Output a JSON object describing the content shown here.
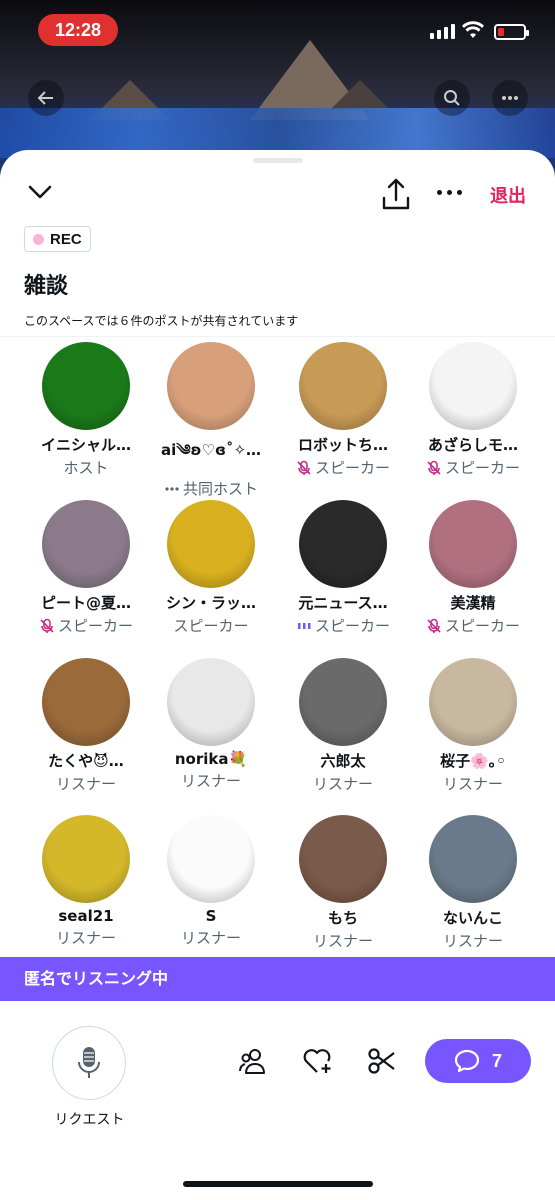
{
  "status_bar": {
    "time": "12:28"
  },
  "header": {
    "leave_label": "退出"
  },
  "space": {
    "rec_label": "REC",
    "title": "雑談",
    "subtitle": "このスペースでは６件のポストが共有されています"
  },
  "participants": [
    {
      "name": "イニシャル…",
      "role": "ホスト",
      "role_icon": "none",
      "avatar_color": "#1a7a1a"
    },
    {
      "name": "ai༄ʚ♡ɞ˚✧…",
      "role": "共同ホスト",
      "role_icon": "dots-icon",
      "avatar_color": "#d8a07a"
    },
    {
      "name": "ロボットち…",
      "role": "スピーカー",
      "role_icon": "muted-mic-icon",
      "avatar_color": "#c79a55"
    },
    {
      "name": "あざらしモ…",
      "role": "スピーカー",
      "role_icon": "muted-mic-icon",
      "avatar_color": "#f4f4f4"
    },
    {
      "name": "ピート@夏…",
      "role": "スピーカー",
      "role_icon": "muted-mic-icon",
      "avatar_color": "#8a7a8a"
    },
    {
      "name": "シン・ラッ…",
      "role": "スピーカー",
      "role_icon": "none",
      "avatar_color": "#d9b020"
    },
    {
      "name": "元ニュース…",
      "role": "スピーカー",
      "role_icon": "speaking-bars-icon",
      "avatar_color": "#2a2a2a"
    },
    {
      "name": "美漢精",
      "role": "スピーカー",
      "role_icon": "muted-mic-icon",
      "avatar_color": "#b07080"
    },
    {
      "name": "たくや😈…",
      "role": "リスナー",
      "role_icon": "none",
      "avatar_color": "#9a6a3a"
    },
    {
      "name": "norika💐",
      "role": "リスナー",
      "role_icon": "none",
      "avatar_color": "#e8e8e8"
    },
    {
      "name": "六郎太",
      "role": "リスナー",
      "role_icon": "none",
      "avatar_color": "#6a6a6a"
    },
    {
      "name": "桜子🌸｡◦",
      "role": "リスナー",
      "role_icon": "none",
      "avatar_color": "#c8b8a0"
    },
    {
      "name": "seal21",
      "role": "リスナー",
      "role_icon": "none",
      "avatar_color": "#d4b82a"
    },
    {
      "name": "S",
      "role": "リスナー",
      "role_icon": "none",
      "avatar_color": "#fbfbfb"
    },
    {
      "name": "もち",
      "role": "リスナー",
      "role_icon": "none",
      "avatar_color": "#7a5a4a"
    },
    {
      "name": "ないんこ",
      "role": "リスナー",
      "role_icon": "none",
      "avatar_color": "#6a7a8a"
    }
  ],
  "listening_banner": "匿名でリスニング中",
  "bottom": {
    "request_label": "リクエスト",
    "comment_count": "7"
  },
  "colors": {
    "accent": "#7856ff",
    "leave": "#e0245e",
    "muted_icon": "#c4308a",
    "time_pill": "#e0312e"
  }
}
